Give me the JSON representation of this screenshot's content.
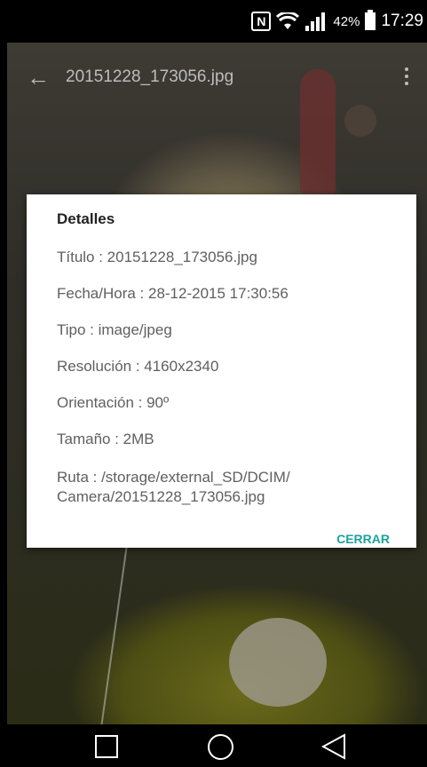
{
  "status_bar": {
    "nfc_glyph": "N",
    "battery_percent": "42%",
    "time": "17:29",
    "icons": [
      "nfc-icon",
      "wifi-icon",
      "signal-icon",
      "battery-icon"
    ]
  },
  "app_bar": {
    "title": "20151228_173056.jpg",
    "back_icon": "arrow-back-icon",
    "menu_icon": "overflow-menu-icon"
  },
  "dialog": {
    "title": "Detalles",
    "rows": [
      "Título : 20151228_173056.jpg",
      "Fecha/Hora : 28-12-2015 17:30:56",
      "Tipo : image/jpeg",
      "Resolución : 4160x2340",
      "Orientación : 90º",
      "Tamaño : 2MB",
      "Ruta : /storage/external_SD/DCIM/",
      "Camera/20151228_173056.jpg"
    ],
    "close_label": "CERRAR",
    "accent_color": "#1ba39c"
  },
  "nav_bar": {
    "icons": [
      "recents-icon",
      "home-icon",
      "back-icon"
    ]
  }
}
